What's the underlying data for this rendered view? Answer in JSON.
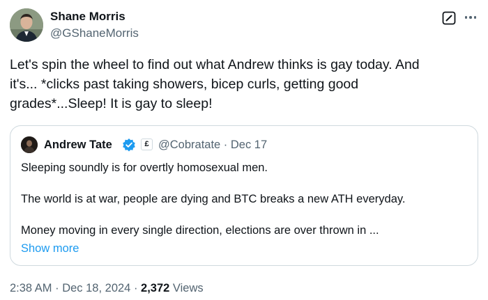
{
  "author": {
    "name": "Shane Morris",
    "handle": "@GShaneMorris",
    "avatar_icon": "profile-photo"
  },
  "actions": {
    "grok_icon": "grok-icon",
    "more_icon": "more-options-icon"
  },
  "tweet": {
    "lines": [
      "Let's spin the wheel to find out what Andrew thinks is gay today. And",
      "it's... *clicks past taking showers, bicep curls, getting good",
      "grades*...Sleep! It is gay to sleep!"
    ]
  },
  "quote": {
    "name": "Andrew Tate",
    "verified_icon": "verified-badge-icon",
    "affiliate_badge": "£",
    "handle": "@Cobratate",
    "date": "Dec 17",
    "meta": "@Cobratate · Dec 17",
    "lines": [
      "Sleeping soundly is for overtly homosexual men.",
      "The world is at war, people are dying and BTC breaks a new ATH everyday.",
      "Money moving in every single direction, elections are over thrown in ..."
    ],
    "show_more": "Show more"
  },
  "footer": {
    "time": "2:38 AM",
    "date": "Dec 18, 2024",
    "time_date": "2:38 AM · Dec 18, 2024 · ",
    "views_count": "2,372",
    "views_label": " Views"
  },
  "colors": {
    "text_primary": "#0f1419",
    "text_secondary": "#536471",
    "link": "#1d9bf0",
    "border": "#cfd9de",
    "verified": "#1d9bf0"
  }
}
